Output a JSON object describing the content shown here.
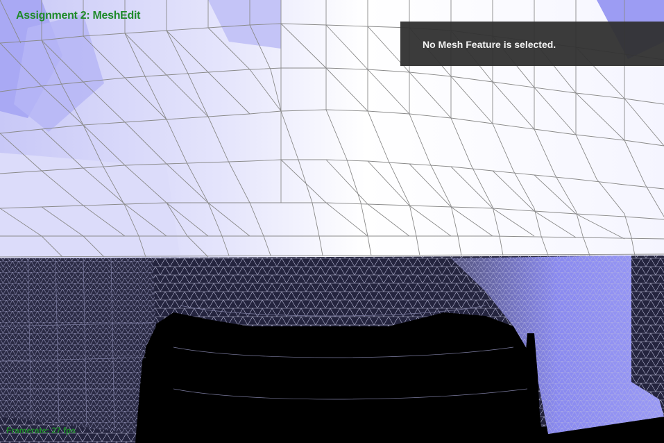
{
  "app": {
    "title": "Assignment 2: MeshEdit"
  },
  "info_panel": {
    "message": "No Mesh Feature is selected."
  },
  "status": {
    "framerate_text": "Framerate: 27 fps"
  },
  "colors": {
    "title_text": "#1f8a2b",
    "panel_bg": "#303030",
    "panel_text": "#f2f2f2",
    "mesh_lit": "#ffffff",
    "mesh_shaded": "#7b7bee",
    "mesh_dark": "#202038",
    "wire": "#8a8a8a",
    "background": "#000000"
  },
  "icons": {
    "mesh": "triangle-mesh-icon"
  }
}
